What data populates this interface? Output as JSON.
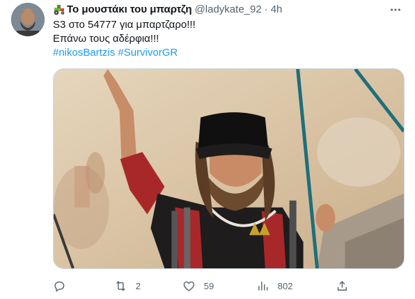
{
  "tweet": {
    "display_name": "Το μουστάκι του μπαρτζη",
    "handle": "@ladykate_92",
    "separator": "·",
    "time": "4h",
    "lines": [
      "S3  στο 54777 για μπαρτζαρο!!!",
      "Επάνω τους αδέρφια!!!"
    ],
    "hashtags": [
      "#nikosBartzis",
      "#SurvivorGR"
    ]
  },
  "icons": {
    "name_emoji": "tractor-icon",
    "more": "more-horizontal-icon",
    "reply": "reply-icon",
    "retweet": "retweet-icon",
    "like": "heart-icon",
    "views": "views-chart-icon",
    "share": "share-icon"
  },
  "actions": {
    "reply_count": "",
    "retweet_count": "2",
    "like_count": "59",
    "views_count": "802"
  },
  "colors": {
    "text": "#0f1419",
    "secondary": "#536471",
    "link": "#1d9bf0",
    "border": "#cfd9de"
  }
}
